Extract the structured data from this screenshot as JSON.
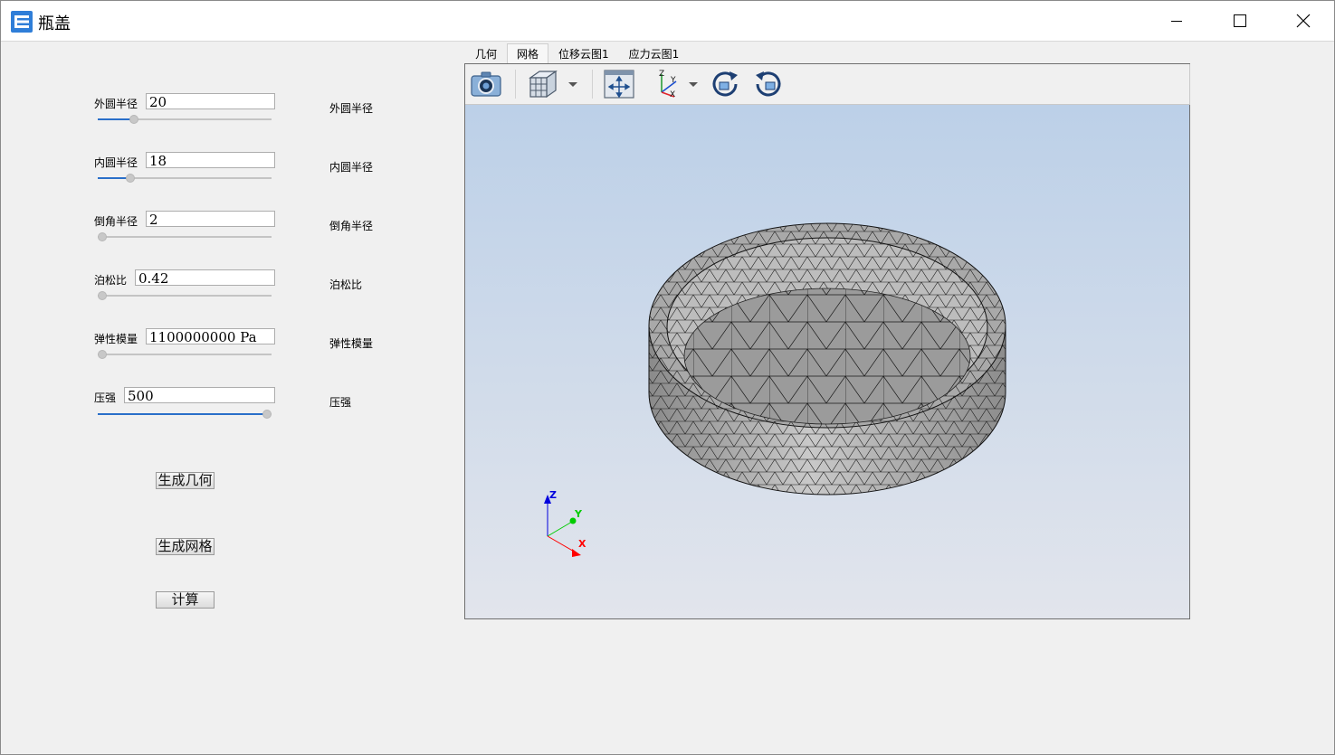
{
  "window": {
    "title": "瓶盖",
    "minimize_icon": "minimize-icon",
    "maximize_icon": "maximize-icon",
    "close_icon": "close-icon"
  },
  "params": [
    {
      "label": "外圆半径",
      "value": "20",
      "right_label": "外圆半径",
      "slider_fraction": 0.19
    },
    {
      "label": "内圆半径",
      "value": "18",
      "right_label": "内圆半径",
      "slider_fraction": 0.17
    },
    {
      "label": "倒角半径",
      "value": "2",
      "right_label": "倒角半径",
      "slider_fraction": 0.0
    },
    {
      "label": "泊松比",
      "value": "0.42",
      "right_label": "泊松比",
      "slider_fraction": 0.0
    },
    {
      "label": "弹性模量",
      "value": "1100000000 Pa",
      "right_label": "弹性模量",
      "slider_fraction": 0.0
    },
    {
      "label": "压强",
      "value": "500",
      "right_label": "压强",
      "slider_fraction": 1.0
    }
  ],
  "buttons": {
    "generate_geometry": "生成几何",
    "generate_mesh": "生成网格",
    "compute": "计算"
  },
  "tabs": [
    "几何",
    "网格",
    "位移云图1",
    "应力云图1"
  ],
  "active_tab": "网格",
  "toolbar": {
    "icons": [
      "camera-icon",
      "cube-view-icon",
      "fit-view-icon",
      "axes-icon",
      "rotate-cw-icon",
      "rotate-ccw-icon"
    ]
  },
  "axes_triad": {
    "x": "X",
    "y": "Y",
    "z": "Z"
  },
  "colors": {
    "accent": "#2a6fc9",
    "x_axis": "#ff0000",
    "y_axis": "#00cc00",
    "z_axis": "#0000dd",
    "mesh_fill": "#a8a8a8"
  }
}
